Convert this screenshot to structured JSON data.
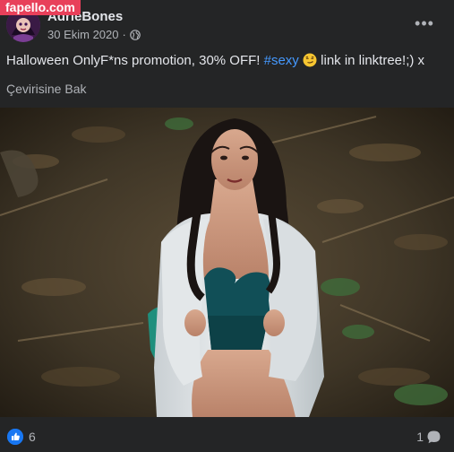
{
  "watermark": "fapello.com",
  "post": {
    "author": "AdrieBones",
    "date": "30 Ekim 2020",
    "separator": "·",
    "text_before": "Halloween OnlyF*ns promotion, 30% OFF! ",
    "hashtag": "#sexy",
    "text_after": " link in linktree!;) x",
    "translate_label": "Çevirisine Bak",
    "more_label": "•••"
  },
  "reactions": {
    "likes": "6",
    "comments": "1"
  },
  "icons": {
    "privacy": "globe-icon",
    "more": "more-options-icon",
    "like": "like-icon",
    "comment": "comment-icon",
    "emoji": "smirk-emoji-icon"
  },
  "colors": {
    "background": "#242526",
    "hashtag": "#4599ff",
    "like_blue": "#1877f2",
    "watermark": "#e8405a"
  }
}
